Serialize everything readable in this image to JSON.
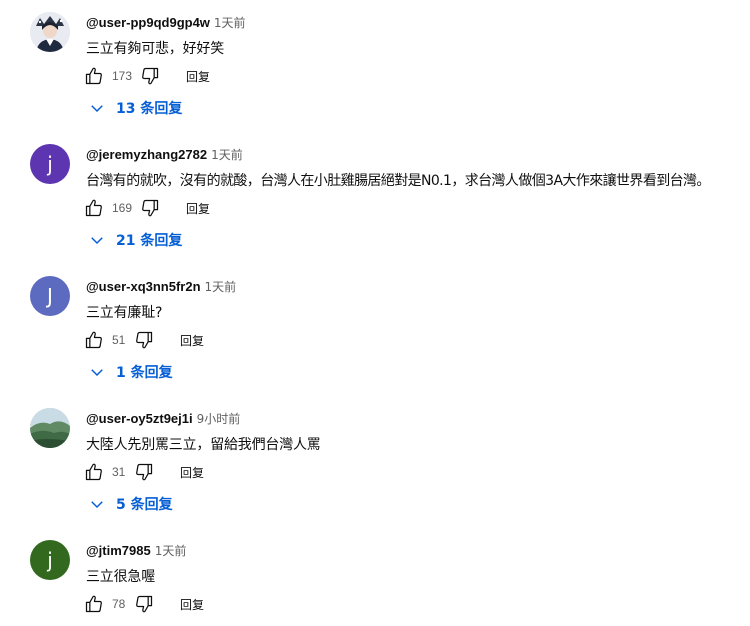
{
  "comments": [
    {
      "author": "@user-pp9qd9gp4w",
      "time": "1天前",
      "text": "三立有夠可悲，好好笑",
      "likes": "173",
      "reply_label": "回复",
      "replies_label": "13 条回复",
      "avatar": {
        "type": "image",
        "icon": "person-photo-avatar"
      }
    },
    {
      "author": "@jeremyzhang2782",
      "time": "1天前",
      "text": "台灣有的就吹，沒有的就酸，台灣人在小肚雞腸居絕對是N0.1，求台灣人做個3A大作來讓世界看到台灣。",
      "likes": "169",
      "reply_label": "回复",
      "replies_label": "21 条回复",
      "avatar": {
        "type": "letter",
        "letter": "j",
        "color": "#5e35b1"
      }
    },
    {
      "author": "@user-xq3nn5fr2n",
      "time": "1天前",
      "text": "三立有廉耻?",
      "likes": "51",
      "reply_label": "回复",
      "replies_label": "1 条回复",
      "avatar": {
        "type": "letter",
        "letter": "J",
        "color": "#5c6bc0"
      }
    },
    {
      "author": "@user-oy5zt9ej1i",
      "time": "9小时前",
      "text": "大陸人先別罵三立，留給我們台灣人罵",
      "likes": "31",
      "reply_label": "回复",
      "replies_label": "5 条回复",
      "avatar": {
        "type": "image",
        "icon": "landscape-photo-avatar"
      }
    },
    {
      "author": "@jtim7985",
      "time": "1天前",
      "text": "三立很急喔",
      "likes": "78",
      "reply_label": "回复",
      "replies_label": "",
      "avatar": {
        "type": "letter",
        "letter": "j",
        "color": "#33691e"
      }
    }
  ],
  "colors": {
    "link": "#065fd4",
    "meta": "#606060",
    "text": "#0f0f0f"
  }
}
